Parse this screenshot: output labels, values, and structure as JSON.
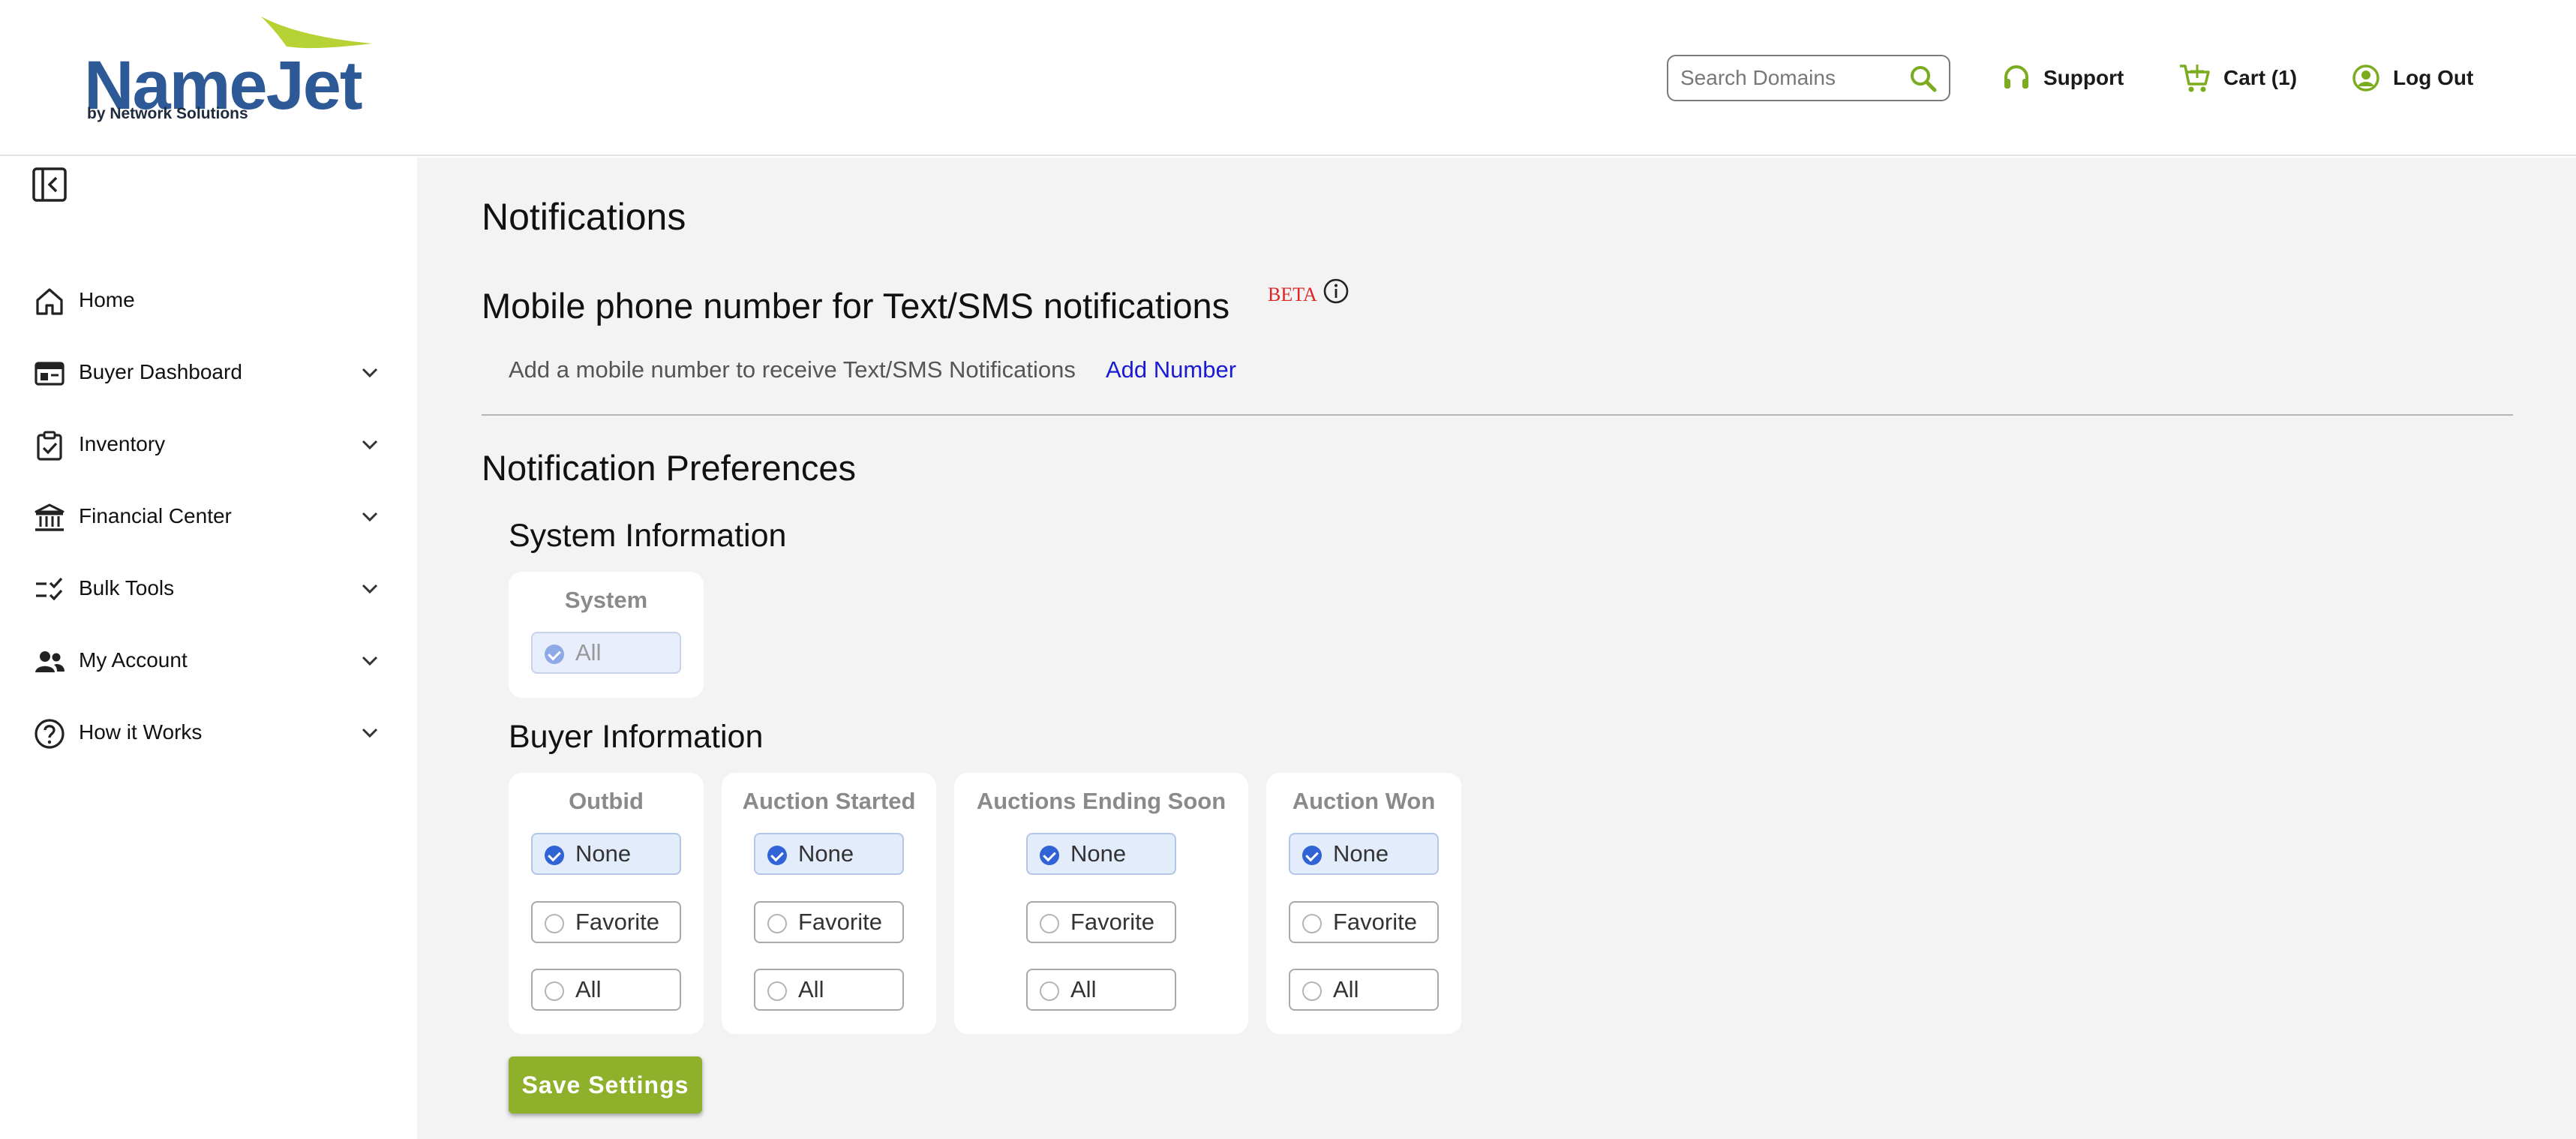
{
  "brand": {
    "logo_word": "NameJet",
    "logo_tagline": "by Network Solutions",
    "primary_color": "#2d5a97",
    "accent_color": "#8fb02b"
  },
  "header": {
    "search_placeholder": "Search Domains",
    "support_label": "Support",
    "cart_label": "Cart (1)",
    "logout_label": "Log Out"
  },
  "sidebar": {
    "items": [
      {
        "label": "Home",
        "icon": "home-icon",
        "expandable": false
      },
      {
        "label": "Buyer Dashboard",
        "icon": "dashboard-icon",
        "expandable": true
      },
      {
        "label": "Inventory",
        "icon": "clipboard-check-icon",
        "expandable": true
      },
      {
        "label": "Financial Center",
        "icon": "bank-icon",
        "expandable": true
      },
      {
        "label": "Bulk Tools",
        "icon": "checklist-icon",
        "expandable": true
      },
      {
        "label": "My Account",
        "icon": "users-icon",
        "expandable": true
      },
      {
        "label": "How it Works",
        "icon": "question-circle-icon",
        "expandable": true
      }
    ]
  },
  "main": {
    "page_title": "Notifications",
    "sms": {
      "heading": "Mobile phone number for Text/SMS notifications",
      "beta_label": "BETA",
      "prompt": "Add a mobile number to receive Text/SMS Notifications",
      "add_link": "Add Number"
    },
    "preferences": {
      "heading": "Notification Preferences",
      "system_section": {
        "heading": "System Information",
        "card_title": "System",
        "option": "All"
      },
      "buyer_section": {
        "heading": "Buyer Information",
        "cards": [
          {
            "title": "Outbid",
            "options": [
              "None",
              "Favorite",
              "All"
            ],
            "selected": "None"
          },
          {
            "title": "Auction Started",
            "options": [
              "None",
              "Favorite",
              "All"
            ],
            "selected": "None"
          },
          {
            "title": "Auctions Ending Soon",
            "options": [
              "None",
              "Favorite",
              "All"
            ],
            "selected": "None"
          },
          {
            "title": "Auction Won",
            "options": [
              "None",
              "Favorite",
              "All"
            ],
            "selected": "None"
          }
        ]
      }
    },
    "save_label": "Save Settings"
  }
}
